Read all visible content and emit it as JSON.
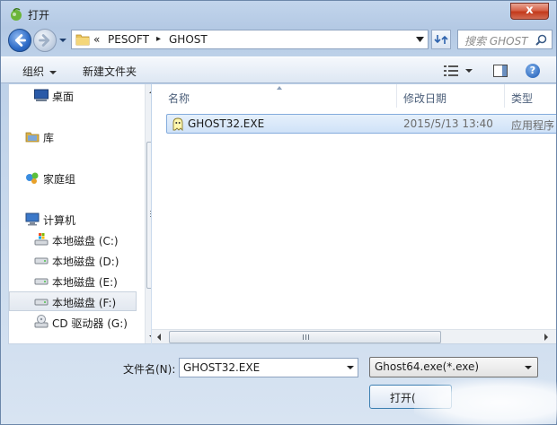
{
  "window": {
    "title": "打开",
    "close_label": "x"
  },
  "address": {
    "prefix": "«",
    "parts": [
      "PESOFT",
      "GHOST"
    ],
    "separator": "▸"
  },
  "search": {
    "placeholder": "搜索 GHOST"
  },
  "toolbar": {
    "organize": "组织",
    "new_folder": "新建文件夹",
    "help": "?"
  },
  "nav": {
    "items": [
      {
        "label": "桌面",
        "icon": "desktop-icon"
      },
      {
        "label": "库",
        "icon": "library-icon"
      },
      {
        "label": "家庭组",
        "icon": "homegroup-icon"
      },
      {
        "label": "计算机",
        "icon": "computer-icon"
      },
      {
        "label": "本地磁盘 (C:)",
        "icon": "system-drive-icon"
      },
      {
        "label": "本地磁盘 (D:)",
        "icon": "drive-icon"
      },
      {
        "label": "本地磁盘 (E:)",
        "icon": "drive-icon"
      },
      {
        "label": "本地磁盘 (F:)",
        "icon": "drive-icon",
        "selected": true
      },
      {
        "label": "CD 驱动器 (G:)",
        "icon": "cd-drive-icon"
      }
    ]
  },
  "columns": {
    "name": "名称",
    "modified": "修改日期",
    "type": "类型"
  },
  "files": [
    {
      "name": "GHOST32.EXE",
      "modified": "2015/5/13 13:40",
      "type": "应用程序",
      "icon": "ghost-exe-icon",
      "selected": true
    }
  ],
  "footer": {
    "filename_label": "文件名(N):",
    "filename_value": "GHOST32.EXE",
    "filter_value": "Ghost64.exe(*.exe)",
    "open_label": "打开("
  },
  "colors": {
    "selection_border": "#84acdd",
    "selection_fill": "#cfe2f8",
    "close_red": "#c3391b"
  }
}
